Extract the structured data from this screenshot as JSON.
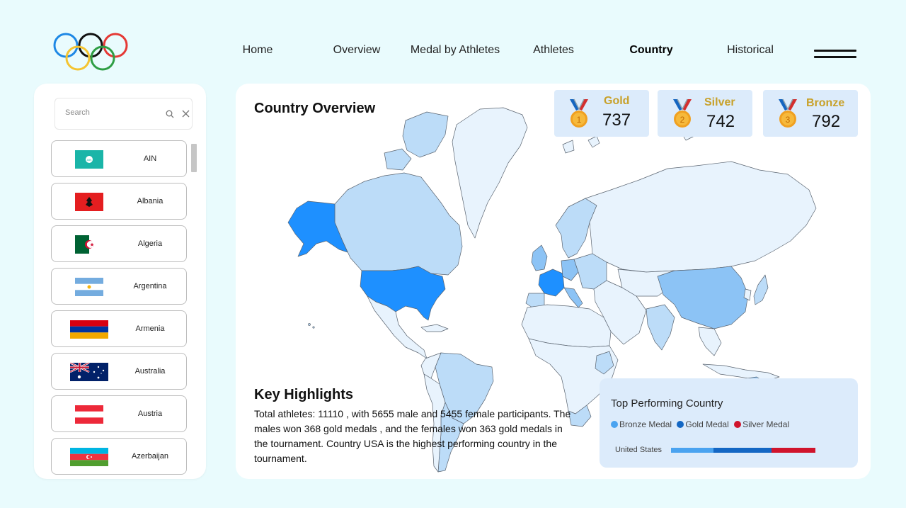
{
  "header": {
    "logo": "olympic-rings-logo",
    "nav": [
      {
        "label": "Home",
        "active": false
      },
      {
        "label": "Overview",
        "active": false
      },
      {
        "label": "Medal by Athletes",
        "active": false
      },
      {
        "label": "Athletes",
        "active": false
      },
      {
        "label": "Country",
        "active": true
      },
      {
        "label": "Historical",
        "active": false
      }
    ],
    "menu_icon": "hamburger-icon"
  },
  "sidebar": {
    "search": {
      "placeholder": "Search",
      "value": ""
    },
    "countries": [
      {
        "name": "AIN",
        "flag": "ain-flag"
      },
      {
        "name": "Albania",
        "flag": "albania-flag"
      },
      {
        "name": "Algeria",
        "flag": "algeria-flag"
      },
      {
        "name": "Argentina",
        "flag": "argentina-flag"
      },
      {
        "name": "Armenia",
        "flag": "armenia-flag"
      },
      {
        "name": "Australia",
        "flag": "australia-flag"
      },
      {
        "name": "Austria",
        "flag": "austria-flag"
      },
      {
        "name": "Azerbaijan",
        "flag": "azerbaijan-flag"
      }
    ]
  },
  "main": {
    "title": "Country Overview",
    "medals": {
      "gold": {
        "label": "Gold",
        "value": "737",
        "badge": "1"
      },
      "silver": {
        "label": "Silver",
        "value": "742",
        "badge": "2"
      },
      "bronze": {
        "label": "Bronze",
        "value": "792",
        "badge": "3"
      }
    },
    "highlights": {
      "title": "Key Highlights",
      "text": "Total athletes: 11110 , with 5655 male and 5455 female participants. The males won 368 gold medals , and the females won 363 gold medals in the tournament. Country USA is the highest performing country in the tournament."
    },
    "top_performing": {
      "title": "Top Performing Country",
      "legend": [
        {
          "label": "Bronze Medal",
          "color": "#4aa3f0"
        },
        {
          "label": "Gold Medal",
          "color": "#1467c4"
        },
        {
          "label": "Silver Medal",
          "color": "#d0142c"
        }
      ],
      "country": "United States",
      "values": {
        "bronze": 0.29,
        "gold": 0.39,
        "silver": 0.3
      }
    },
    "map_colors": {
      "highest": "#1e90ff",
      "high": "#8cc3f5",
      "mid": "#bcdcf8",
      "low": "#e8f3fd",
      "stroke": "#5a6470"
    }
  }
}
